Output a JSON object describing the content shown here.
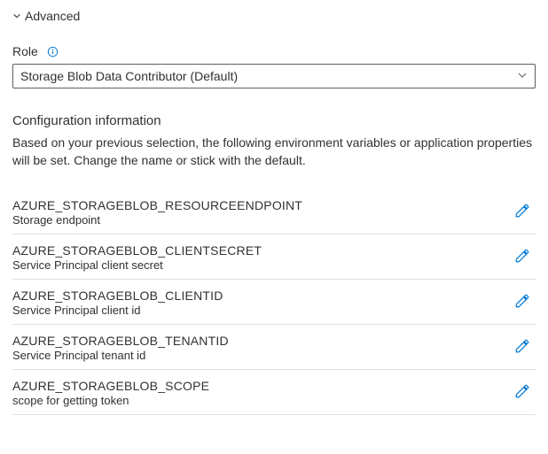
{
  "header": {
    "advanced_label": "Advanced"
  },
  "role": {
    "label": "Role",
    "selected": "Storage Blob Data Contributor (Default)"
  },
  "config": {
    "title": "Configuration information",
    "description": "Based on your previous selection, the following environment variables or application properties will be set. Change the name or stick with the default.",
    "items": [
      {
        "name": "AZURE_STORAGEBLOB_RESOURCEENDPOINT",
        "desc": "Storage endpoint"
      },
      {
        "name": "AZURE_STORAGEBLOB_CLIENTSECRET",
        "desc": "Service Principal client secret"
      },
      {
        "name": "AZURE_STORAGEBLOB_CLIENTID",
        "desc": "Service Principal client id"
      },
      {
        "name": "AZURE_STORAGEBLOB_TENANTID",
        "desc": "Service Principal tenant id"
      },
      {
        "name": "AZURE_STORAGEBLOB_SCOPE",
        "desc": "scope for getting token"
      }
    ]
  }
}
